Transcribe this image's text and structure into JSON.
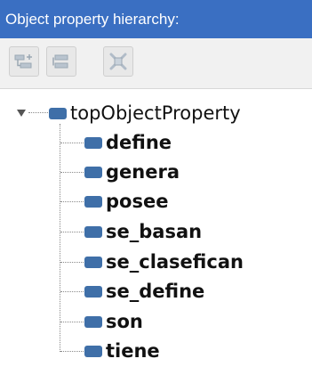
{
  "panel": {
    "title": "Object property hierarchy:",
    "accent_color": "#3a6fc2",
    "node_color": "#3f6fa8"
  },
  "toolbar": {
    "buttons": [
      {
        "icon": "add-subproperty-icon",
        "enabled": false
      },
      {
        "icon": "add-sibling-property-icon",
        "enabled": false
      },
      {
        "icon": "delete-property-icon",
        "enabled": false
      }
    ]
  },
  "tree": {
    "root": {
      "label": "topObjectProperty",
      "expanded": true,
      "children": [
        {
          "label": "define"
        },
        {
          "label": "genera"
        },
        {
          "label": "posee"
        },
        {
          "label": "se_basan"
        },
        {
          "label": "se_clasefican"
        },
        {
          "label": "se_define"
        },
        {
          "label": "son"
        },
        {
          "label": "tiene"
        }
      ]
    }
  }
}
